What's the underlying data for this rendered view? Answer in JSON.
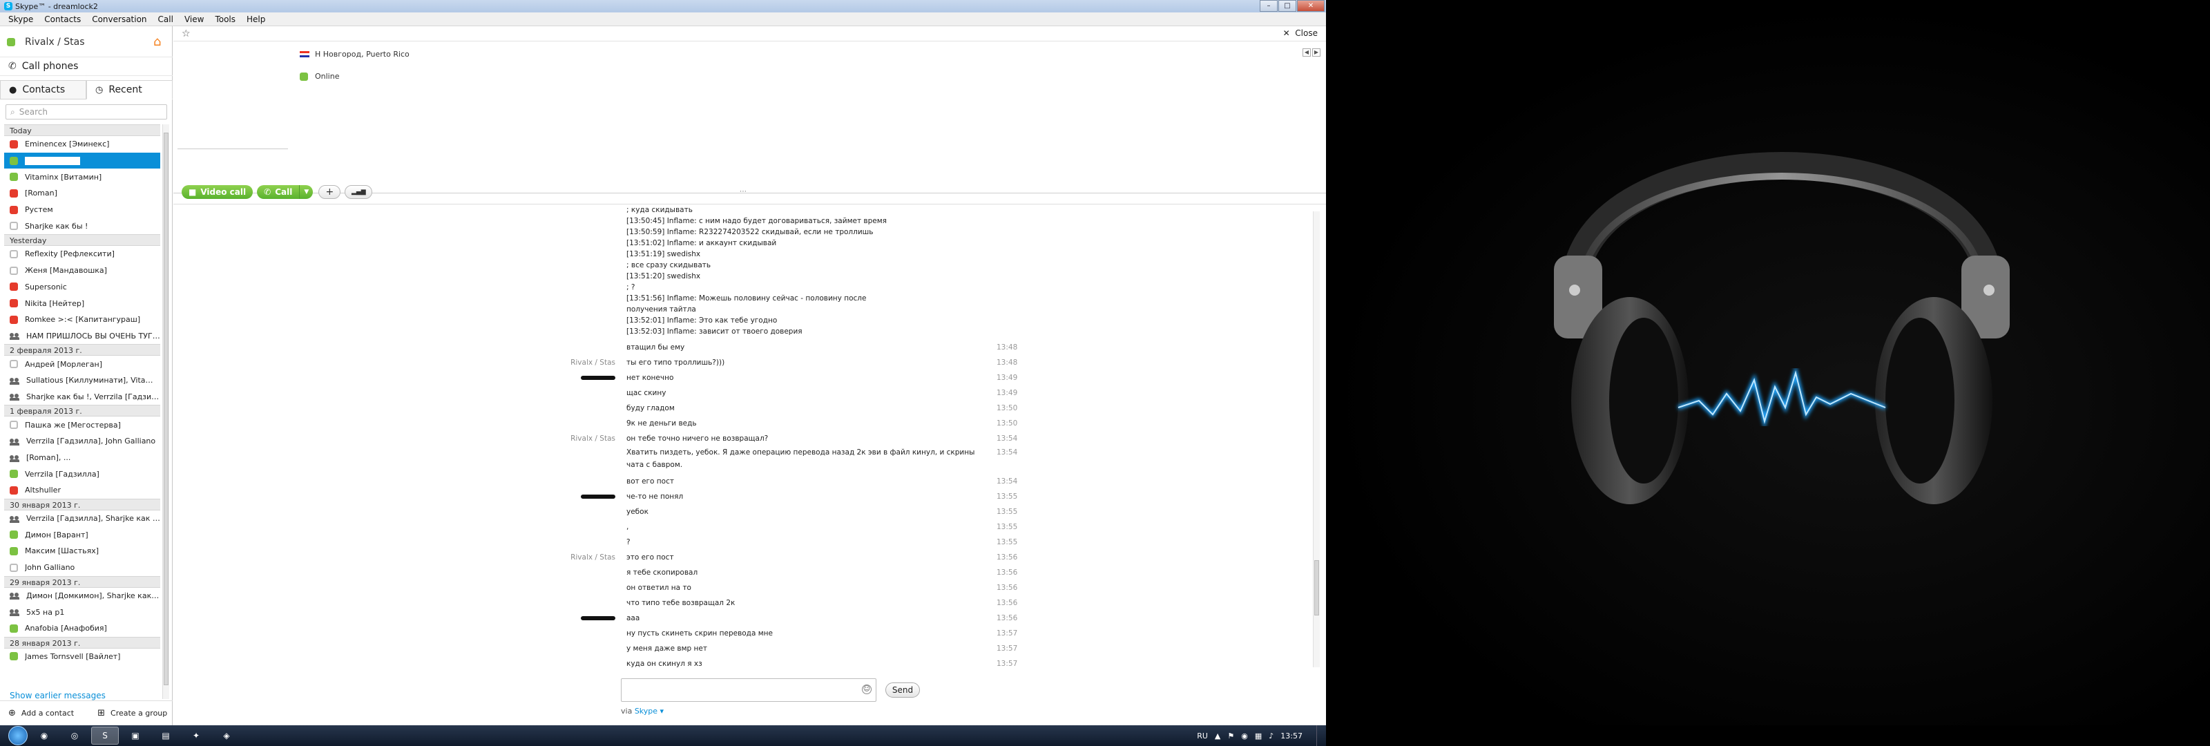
{
  "window": {
    "title": "Skype™ - dreamlock2",
    "min": "–",
    "max": "□",
    "close": "✕"
  },
  "menu": [
    "Skype",
    "Contacts",
    "Conversation",
    "Call",
    "View",
    "Tools",
    "Help"
  ],
  "sidebar": {
    "user": "Rivalx / Stas",
    "call_phones": "Call phones",
    "tabs": {
      "contacts": "Contacts",
      "recent": "Recent"
    },
    "search_placeholder": "Search",
    "groups": [
      {
        "label": "Today",
        "items": [
          {
            "name": "Eminencex [Эминекс]",
            "status": "dnd"
          },
          {
            "name": "",
            "status": "on",
            "selected": true
          },
          {
            "name": "Vitaminx [Витамин]",
            "status": "on"
          },
          {
            "name": "[Roman]",
            "status": "dnd"
          },
          {
            "name": "Рустем",
            "status": "dnd"
          },
          {
            "name": "Sharjke как бы !",
            "status": "off"
          }
        ]
      },
      {
        "label": "Yesterday",
        "items": [
          {
            "name": "Reflexity [Рефлексити]",
            "status": "off"
          },
          {
            "name": "Женя [Мандавошка]",
            "status": "off"
          },
          {
            "name": "Supersonic",
            "status": "dnd"
          },
          {
            "name": "Nikita [Нейтер]",
            "status": "dnd"
          },
          {
            "name": "Romkee >:< [Капитангураш]",
            "status": "dnd"
          },
          {
            "name": "НАМ ПРИШЛОСЬ ВЫ ОЧЕНЬ ТУГО Е...",
            "status": "grp"
          }
        ]
      },
      {
        "label": "2 февраля 2013 г.",
        "items": [
          {
            "name": "Андрей [Морлеган]",
            "status": "off"
          },
          {
            "name": "Sullatious [Киллуминати], Vitaminx [...",
            "status": "grp"
          },
          {
            "name": "Sharjke как бы !, Verrzila [Гадзилла]",
            "status": "grp"
          }
        ]
      },
      {
        "label": "1 февраля 2013 г.",
        "items": [
          {
            "name": "Пашка же [Мегостерва]",
            "status": "off"
          },
          {
            "name": "Verrzila [Гадзилла], John Galliano",
            "status": "grp"
          },
          {
            "name": "[Roman], ...",
            "status": "grp"
          },
          {
            "name": "Verrzila [Гадзилла]",
            "status": "on"
          },
          {
            "name": "Altshuller",
            "status": "dnd"
          }
        ]
      },
      {
        "label": "30 января 2013 г.",
        "items": [
          {
            "name": "Verrzila [Гадзилла], Sharjke как бы !",
            "status": "grp"
          },
          {
            "name": "Димон [Варант]",
            "status": "on"
          },
          {
            "name": "Максим [Шастьях]",
            "status": "on"
          },
          {
            "name": "John Galliano",
            "status": "off"
          }
        ]
      },
      {
        "label": "29 января 2013 г.",
        "items": [
          {
            "name": "Димон [Домкимон], Sharjke как бы !",
            "status": "grp"
          },
          {
            "name": "5х5 на р1",
            "status": "grp"
          },
          {
            "name": "Anafobia [Анафобия]",
            "status": "on"
          }
        ]
      },
      {
        "label": "28 января 2013 г.",
        "items": [
          {
            "name": "James Tornsvell [Вайлет]",
            "status": "on"
          }
        ]
      }
    ],
    "show_earlier": "Show earlier messages",
    "add_contact": "Add a contact",
    "create_group": "Create a group"
  },
  "profile": {
    "location": "Н Новгород, Puerto Rico",
    "status": "Online",
    "close": "Close"
  },
  "callbar": {
    "video": "Video call",
    "call": "Call",
    "add": "+",
    "signal": "▂▄▆"
  },
  "quote": [
    "; куда скидывать",
    "[13:50:45] Inflame: с ним надо будет договариваться, займет время",
    "[13:50:59] Inflame: R232274203522 скидывай, если не троллишь",
    "[13:51:02] Inflame: и аккаунт скидывай",
    "[13:51:19] swedishx",
    "; все сразу скидывать",
    "[13:51:20] swedishx",
    "; ?",
    "[13:51:56] Inflame: Можешь половину сейчас - половину после",
    "получения тайтла",
    "[13:52:01] Inflame: Это как тебе угодно",
    "[13:52:03] Inflame: зависит от твоего доверия"
  ],
  "messages": [
    {
      "from": "",
      "text": "втащил бы ему",
      "time": "13:48"
    },
    {
      "from": "Rivalx / Stas",
      "text": "ты его типо троллишь?)))",
      "time": "13:48"
    },
    {
      "from": "hidden",
      "text": "нет конечно",
      "time": "13:49"
    },
    {
      "from": "",
      "text": "щас скину",
      "time": "13:49"
    },
    {
      "from": "",
      "text": "буду гладом",
      "time": "13:50"
    },
    {
      "from": "",
      "text": "9к не деньги ведь",
      "time": "13:50"
    },
    {
      "from": "Rivalx / Stas",
      "text": "он тебе точно ничего не возвращал?",
      "time": "13:54"
    },
    {
      "from": "",
      "text": "Хватить пиздеть, уебок. Я даже операцию перевода назад 2к эви в файл кинул, и скрины чата с бавром.",
      "time": "13:54",
      "two": true
    },
    {
      "from": "",
      "text": "вот его пост",
      "time": "13:54"
    },
    {
      "from": "hidden",
      "text": "че-то не понял",
      "time": "13:55"
    },
    {
      "from": "",
      "text": "уебок",
      "time": "13:55"
    },
    {
      "from": "",
      "text": ",",
      "time": "13:55"
    },
    {
      "from": "",
      "text": "?",
      "time": "13:55"
    },
    {
      "from": "Rivalx / Stas",
      "text": "это его пост",
      "time": "13:56"
    },
    {
      "from": "",
      "text": "я тебе скопировал",
      "time": "13:56"
    },
    {
      "from": "",
      "text": "он ответил на то",
      "time": "13:56"
    },
    {
      "from": "",
      "text": "что типо тебе возвращал 2к",
      "time": "13:56"
    },
    {
      "from": "hidden",
      "text": "ааа",
      "time": "13:56"
    },
    {
      "from": "",
      "text": "ну пусть скинеть скрин перевода мне",
      "time": "13:57"
    },
    {
      "from": "",
      "text": "у меня даже вмр нет",
      "time": "13:57"
    },
    {
      "from": "",
      "text": "куда он скинул я хз",
      "time": "13:57"
    }
  ],
  "composer": {
    "placeholder": "",
    "send": "Send",
    "via_prefix": "via",
    "via_link": "Skype ▾"
  },
  "taskbar": {
    "lang": "RU",
    "clock": "13:57"
  }
}
